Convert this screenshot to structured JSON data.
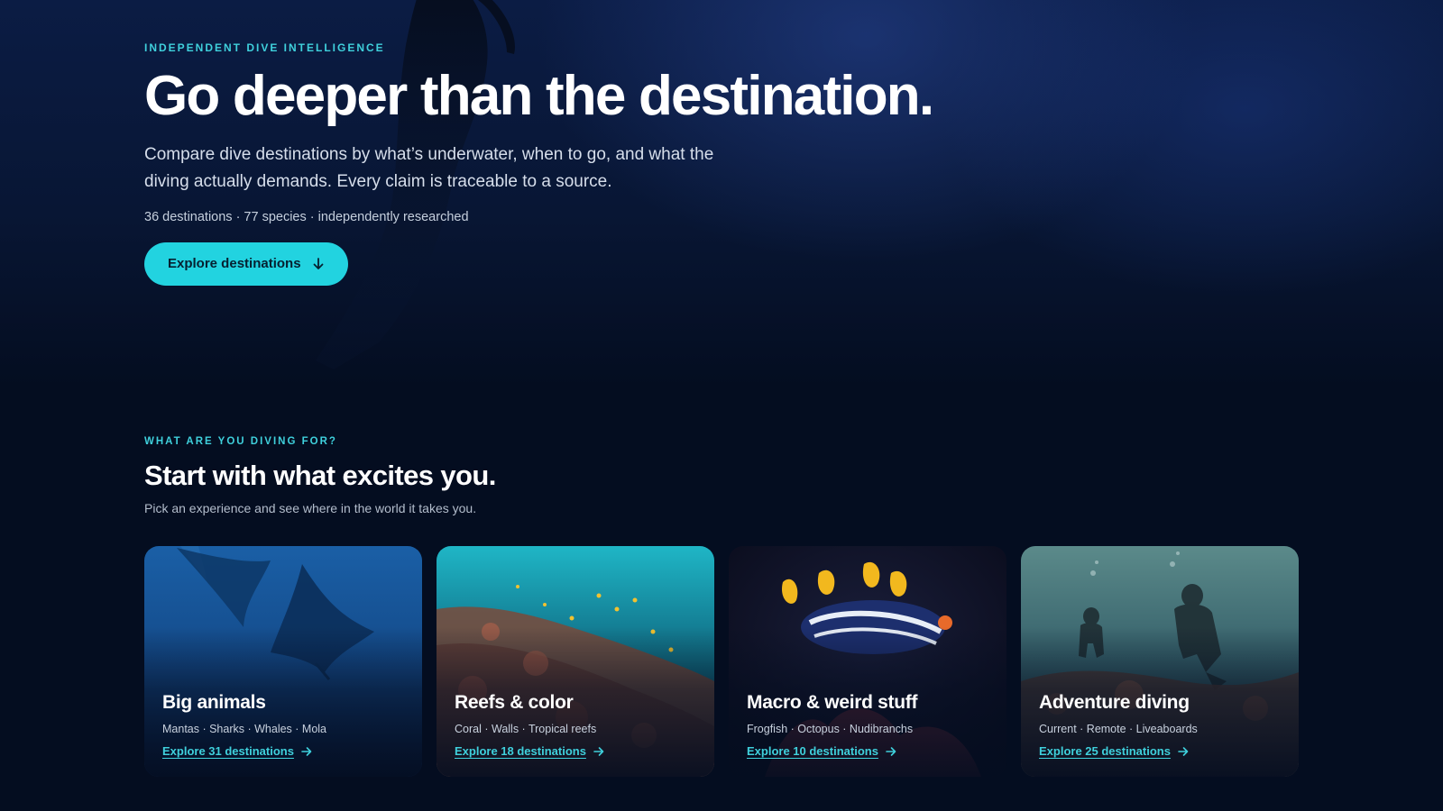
{
  "hero": {
    "eyebrow": "INDEPENDENT DIVE INTELLIGENCE",
    "title": "Go deeper than the destination.",
    "description": "Compare dive destinations by what’s underwater, when to go, and what the diving actually demands. Every claim is traceable to a source.",
    "stats": "36 destinations · 77 species · independently researched",
    "cta_label": "Explore destinations",
    "cta_icon": "arrow-down-icon"
  },
  "section": {
    "eyebrow": "WHAT ARE YOU DIVING FOR?",
    "title": "Start with what excites you.",
    "subtitle": "Pick an experience and see where in the world it takes you."
  },
  "cards": [
    {
      "title": "Big animals",
      "tags": "Mantas · Sharks · Whales · Mola",
      "link": "Explore 31 destinations",
      "image": "manta-rays-image"
    },
    {
      "title": "Reefs & color",
      "tags": "Coral · Walls · Tropical reefs",
      "link": "Explore 18 destinations",
      "image": "coral-reef-image"
    },
    {
      "title": "Macro & weird stuff",
      "tags": "Frogfish · Octopus · Nudibranchs",
      "link": "Explore 10 destinations",
      "image": "nudibranch-image"
    },
    {
      "title": "Adventure diving",
      "tags": "Current · Remote · Liveaboards",
      "link": "Explore 25 destinations",
      "image": "divers-image"
    }
  ],
  "colors": {
    "background": "#040d20",
    "accent": "#22d3e0",
    "eyebrow": "#3fd0dc"
  }
}
